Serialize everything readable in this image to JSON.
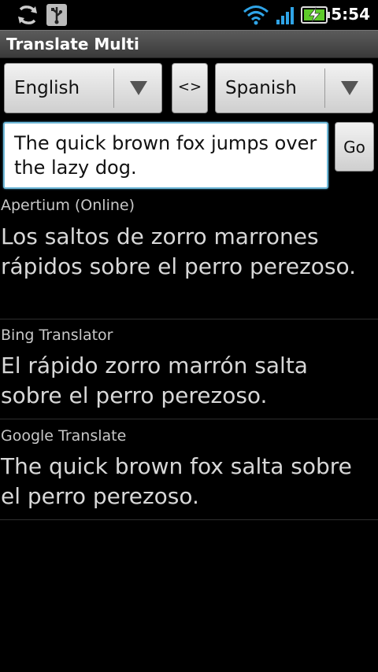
{
  "status": {
    "time": "5:54",
    "icons": [
      "sync-icon",
      "usb-icon",
      "wifi-icon",
      "signal-icon",
      "battery-charging-icon"
    ]
  },
  "app": {
    "title": "Translate Multi"
  },
  "controls": {
    "source_language": "English",
    "swap_label": "<>",
    "target_language": "Spanish",
    "input_text": "The quick brown fox jumps over the lazy dog.",
    "go_label": "Go"
  },
  "results": [
    {
      "source": "Apertium (Online)",
      "translation": "Los saltos de zorro marrones rápidos sobre el perro perezoso."
    },
    {
      "source": "Bing Translator",
      "translation": "El rápido zorro marrón salta sobre el perro perezoso."
    },
    {
      "source": "Google Translate",
      "translation": "The quick brown fox salta sobre el perro perezoso."
    }
  ]
}
